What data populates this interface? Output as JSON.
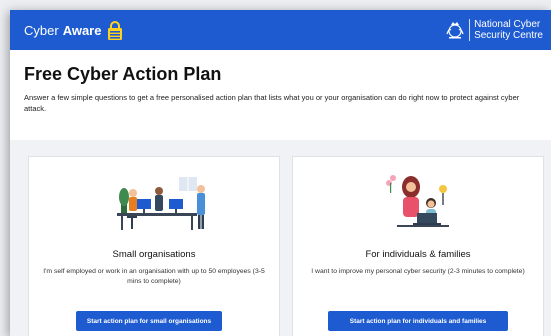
{
  "header": {
    "brand_word1": "Cyber",
    "brand_word2": "Aware",
    "brand_icon": "padlock-icon",
    "ncsc_line1": "National Cyber",
    "ncsc_line2": "Security Centre",
    "ncsc_icon": "royal-crest-icon",
    "color": "#1e5bd1"
  },
  "intro": {
    "title": "Free Cyber Action Plan",
    "description": "Answer a few simple questions to get a free personalised action plan that lists what you or your organisation can do right now to protect against cyber attack."
  },
  "cards": [
    {
      "title": "Small organisations",
      "description": "I'm self employed or work in an organisation with up to 50 employees (3-5 mins to complete)",
      "button": "Start action plan for small organisations",
      "illustration": "office-team-illustration"
    },
    {
      "title": "For individuals & families",
      "description": "I want to improve my personal cyber security (2-3 minutes to complete)",
      "button": "Start action plan for individuals and families",
      "illustration": "family-illustration"
    }
  ]
}
